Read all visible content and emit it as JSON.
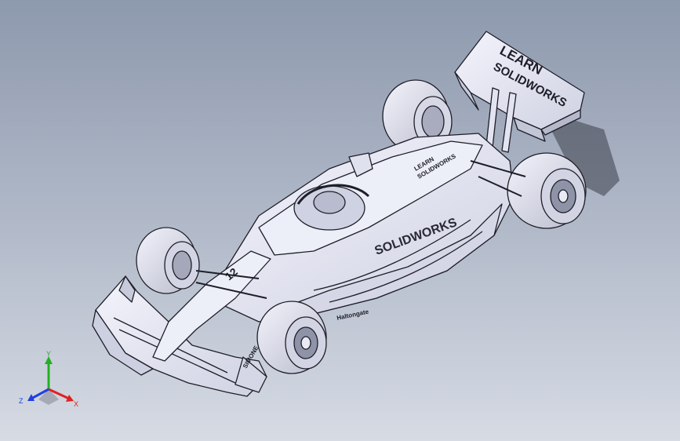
{
  "viewport": {
    "colors": {
      "bg_top": "#8d99ad",
      "bg_bottom": "#d6dbe4",
      "shell": "#e7e8f5",
      "edge": "#1e1e28"
    }
  },
  "model": {
    "rear_wing_text_1": "LEARN",
    "rear_wing_text_2": "SOLIDWORKS",
    "sidepod_text": "SOLIDWORKS",
    "engine_cover_text_1": "LEARN",
    "engine_cover_text_2": "SOLIDWORKS",
    "nose_number": "12",
    "floor_sponsor": "Haltongate",
    "endplate_text": "SIMONE"
  },
  "triad": {
    "x_label": "X",
    "y_label": "Y",
    "z_label": "Z",
    "x_color": "#e02020",
    "y_color": "#22b022",
    "z_color": "#2040e0"
  }
}
